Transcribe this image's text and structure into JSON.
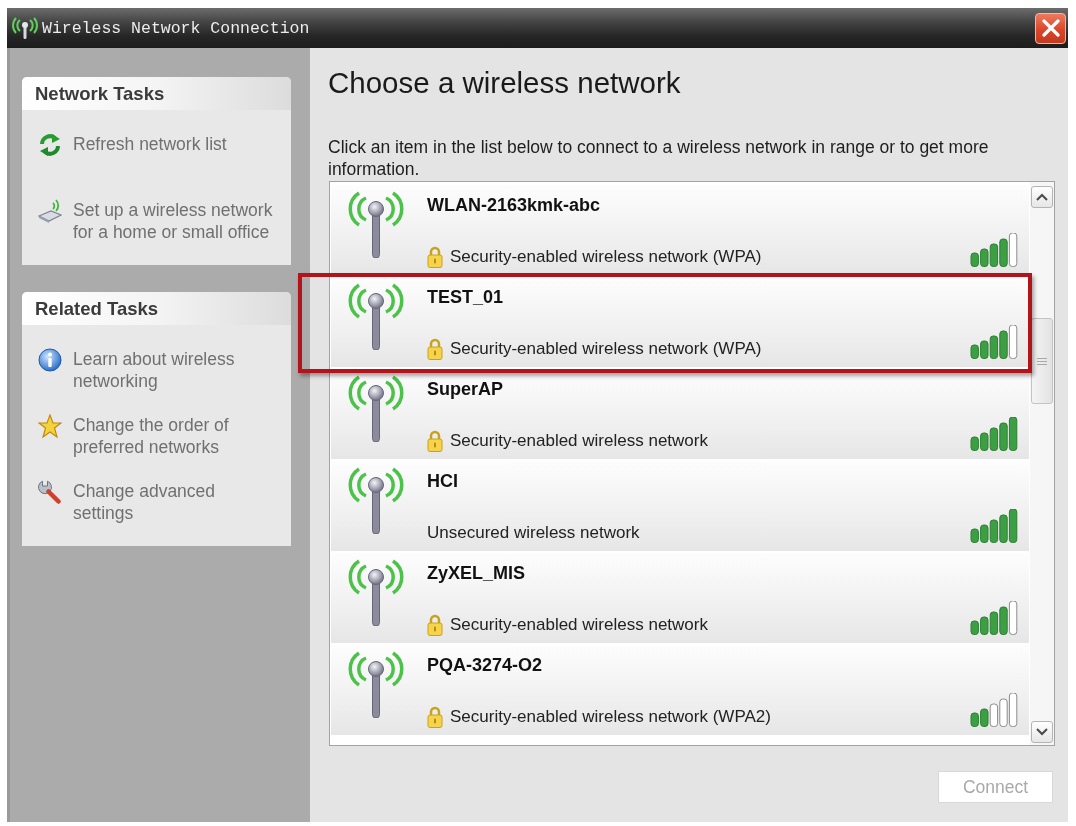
{
  "window": {
    "title": "Wireless Network Connection"
  },
  "sidebar": {
    "sections": [
      {
        "title": "Network Tasks",
        "items": [
          {
            "label": "Refresh network list"
          },
          {
            "label": "Set up a wireless network for a home or small office"
          }
        ]
      },
      {
        "title": "Related Tasks",
        "items": [
          {
            "label": "Learn about wireless networking"
          },
          {
            "label": "Change the order of preferred networks"
          },
          {
            "label": "Change advanced settings"
          }
        ]
      }
    ]
  },
  "main": {
    "heading": "Choose a wireless network",
    "description": "Click an item in the list below to connect to a wireless network in range or to get more information."
  },
  "networks": [
    {
      "kind": "strong",
      "name": "WLAN-2163kmk-abc",
      "status": "Security-enabled wireless network (WPA)",
      "secured": true,
      "highlighted": false
    },
    {
      "kind": "strong",
      "name": "TEST_01",
      "status": "Security-enabled wireless network (WPA)",
      "secured": true,
      "highlighted": true
    },
    {
      "kind": "full",
      "name": "SuperAP",
      "status": "Security-enabled wireless network",
      "secured": true,
      "highlighted": false
    },
    {
      "kind": "full",
      "name": "HCI",
      "status": "Unsecured wireless network",
      "secured": false,
      "highlighted": false
    },
    {
      "kind": "strong",
      "name": "ZyXEL_MIS",
      "status": "Security-enabled wireless network",
      "secured": true,
      "highlighted": false
    },
    {
      "kind": "weak",
      "name": "PQA-3274-O2",
      "status": "Security-enabled wireless network (WPA2)",
      "secured": true,
      "highlighted": false
    }
  ],
  "buttons": [
    {
      "label": "Connect",
      "disabled": true
    }
  ]
}
